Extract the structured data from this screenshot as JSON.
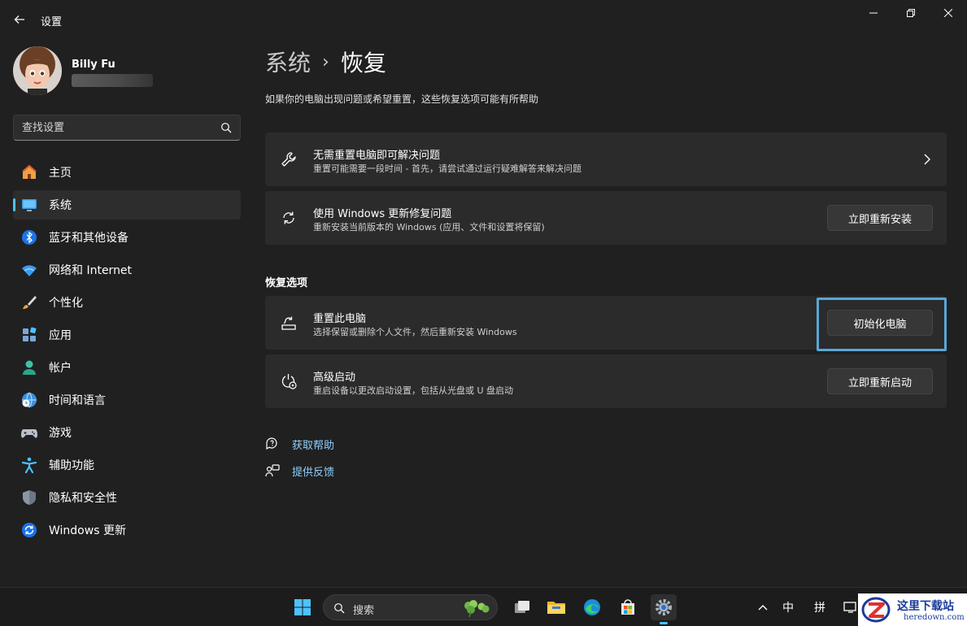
{
  "window": {
    "title": "设置"
  },
  "profile": {
    "name": "Billy Fu"
  },
  "search": {
    "placeholder": "查找设置"
  },
  "sidebar": {
    "items": [
      {
        "label": "主页",
        "icon": "home-icon"
      },
      {
        "label": "系统",
        "icon": "system-monitor-icon",
        "active": true
      },
      {
        "label": "蓝牙和其他设备",
        "icon": "bluetooth-icon"
      },
      {
        "label": "网络和 Internet",
        "icon": "wifi-icon"
      },
      {
        "label": "个性化",
        "icon": "paintbrush-icon"
      },
      {
        "label": "应用",
        "icon": "apps-icon"
      },
      {
        "label": "帐户",
        "icon": "account-icon"
      },
      {
        "label": "时间和语言",
        "icon": "globe-clock-icon"
      },
      {
        "label": "游戏",
        "icon": "gamepad-icon"
      },
      {
        "label": "辅助功能",
        "icon": "accessibility-icon"
      },
      {
        "label": "隐私和安全性",
        "icon": "shield-icon"
      },
      {
        "label": "Windows 更新",
        "icon": "windows-update-icon"
      }
    ]
  },
  "breadcrumb": {
    "parent": "系统",
    "separator": "›",
    "current": "恢复"
  },
  "page": {
    "description": "如果你的电脑出现问题或希望重置，这些恢复选项可能有所帮助"
  },
  "cards": {
    "troubleshoot": {
      "title": "无需重置电脑即可解决问题",
      "subtitle": "重置可能需要一段时间 - 首先，请尝试通过运行疑难解答来解决问题"
    },
    "windows_update": {
      "title": "使用 Windows 更新修复问题",
      "subtitle": "重新安装当前版本的 Windows (应用、文件和设置将保留)",
      "button": "立即重新安装"
    }
  },
  "recovery_options": {
    "section_title": "恢复选项",
    "reset": {
      "title": "重置此电脑",
      "subtitle": "选择保留或删除个人文件，然后重新安装 Windows",
      "button": "初始化电脑"
    },
    "advanced": {
      "title": "高级启动",
      "subtitle": "重启设备以更改启动设置，包括从光盘或 U 盘启动",
      "button": "立即重新启动"
    }
  },
  "links": {
    "get_help": "获取帮助",
    "feedback": "提供反馈"
  },
  "taskbar": {
    "search_label": "搜索",
    "ime_lang": "中",
    "ime_mode": "拼"
  },
  "watermark": {
    "title": "这里下载站",
    "url": "heredown.com"
  },
  "colors": {
    "background": "#202020",
    "card": "#2b2b2b",
    "accent": "#4cc2ff",
    "link": "#8fd0ff",
    "focus_frame": "#5aa7d8"
  }
}
